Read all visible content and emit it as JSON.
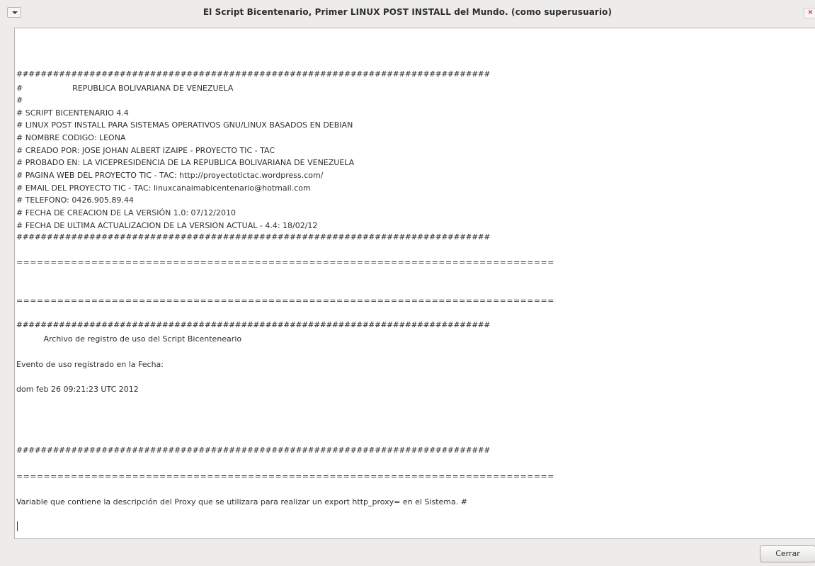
{
  "window": {
    "title": "El Script Bicentenario, Primer LINUX POST INSTALL del Mundo. (como superusuario)",
    "close_glyph": "×"
  },
  "log_lines": [
    "##############################################################################",
    "#                    REPUBLICA BOLIVARIANA DE VENEZUELA",
    "#",
    "# SCRIPT BICENTENARIO 4.4",
    "# LINUX POST INSTALL PARA SISTEMAS OPERATIVOS GNU/LINUX BASADOS EN DEBIAN",
    "# NOMBRE CODIGO: LEONA",
    "# CREADO POR: JOSE JOHAN ALBERT IZAIPE - PROYECTO TIC - TAC",
    "# PROBADO EN: LA VICEPRESIDENCIA DE LA REPUBLICA BOLIVARIANA DE VENEZUELA",
    "# PAGINA WEB DEL PROYECTO TIC - TAC: http://proyectotictac.wordpress.com/",
    "# EMAIL DEL PROYECTO TIC - TAC: linuxcanaimabicentenario@hotmail.com",
    "# TELEFONO: 0426.905.89.44",
    "# FECHA DE CREACION DE LA VERSIÓN 1.0: 07/12/2010",
    "# FECHA DE ULTIMA ACTUALIZACION DE LA VERSION ACTUAL - 4.4: 18/02/12",
    "##############################################################################",
    "===============================================================================",
    "===============================================================================",
    "##############################################################################",
    "           Archivo de registro de uso del Script Bicenteneario",
    "Evento de uso registrado en la Fecha:",
    "dom feb 26 09:21:23 UTC 2012",
    "##############################################################################",
    "===============================================================================",
    "Variable que contiene la descripción del Proxy que se utilizara para realizar un export http_proxy= en el Sistema. #"
  ],
  "buttons": {
    "close_label": "Cerrar"
  }
}
